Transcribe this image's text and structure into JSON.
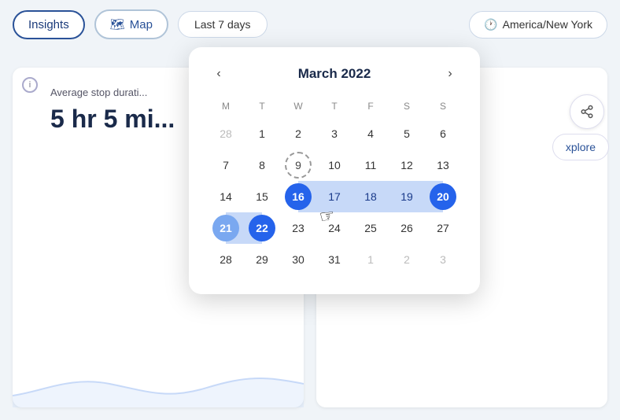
{
  "nav": {
    "insights_label": "Insights",
    "map_label": "Map",
    "date_range_label": "Last 7 days",
    "timezone_label": "America/New York"
  },
  "card1": {
    "label": "Average stop durati...",
    "value": "5 hr 5 mi..."
  },
  "share_btn": "share",
  "explore_btn": "xplore",
  "calendar": {
    "title": "March 2022",
    "days_of_week": [
      "M",
      "T",
      "W",
      "T",
      "F",
      "S",
      "S"
    ],
    "weeks": [
      [
        {
          "day": "28",
          "type": "other-month"
        },
        {
          "day": "1",
          "type": "normal"
        },
        {
          "day": "2",
          "type": "normal"
        },
        {
          "day": "3",
          "type": "normal"
        },
        {
          "day": "4",
          "type": "normal"
        },
        {
          "day": "5",
          "type": "normal"
        },
        {
          "day": "6",
          "type": "normal"
        }
      ],
      [
        {
          "day": "7",
          "type": "normal"
        },
        {
          "day": "8",
          "type": "normal"
        },
        {
          "day": "9",
          "type": "hovered"
        },
        {
          "day": "10",
          "type": "normal"
        },
        {
          "day": "11",
          "type": "normal"
        },
        {
          "day": "12",
          "type": "normal"
        },
        {
          "day": "13",
          "type": "normal"
        }
      ],
      [
        {
          "day": "14",
          "type": "normal"
        },
        {
          "day": "15",
          "type": "normal"
        },
        {
          "day": "16",
          "type": "range-start-pill"
        },
        {
          "day": "17",
          "type": "range-middle-inner"
        },
        {
          "day": "18",
          "type": "range-middle-inner"
        },
        {
          "day": "19",
          "type": "range-middle-inner"
        },
        {
          "day": "20",
          "type": "range-end-pill-row1"
        }
      ],
      [
        {
          "day": "21",
          "type": "range-start-pill-row2"
        },
        {
          "day": "22",
          "type": "range-end-pill"
        },
        {
          "day": "23",
          "type": "normal"
        },
        {
          "day": "24",
          "type": "normal"
        },
        {
          "day": "25",
          "type": "normal"
        },
        {
          "day": "26",
          "type": "normal"
        },
        {
          "day": "27",
          "type": "normal"
        }
      ],
      [
        {
          "day": "28",
          "type": "normal"
        },
        {
          "day": "29",
          "type": "normal"
        },
        {
          "day": "30",
          "type": "normal"
        },
        {
          "day": "31",
          "type": "normal"
        },
        {
          "day": "1",
          "type": "other-month"
        },
        {
          "day": "2",
          "type": "other-month"
        },
        {
          "day": "3",
          "type": "other-month"
        }
      ]
    ]
  }
}
